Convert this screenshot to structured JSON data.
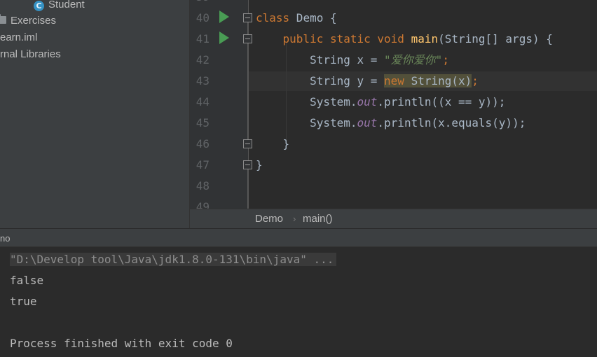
{
  "project_tree": {
    "items": [
      {
        "label": "Student",
        "icon": "class-icon",
        "icon_letter": "C"
      },
      {
        "label": "Exercises",
        "icon": "folder-icon"
      },
      {
        "label": "earn.iml"
      },
      {
        "label": "rnal Libraries"
      }
    ]
  },
  "editor": {
    "line_numbers": [
      "40",
      "41",
      "42",
      "43",
      "44",
      "45",
      "46",
      "47",
      "48",
      "49"
    ],
    "lines": {
      "l40": {
        "kw": "class",
        "rest": " Demo {"
      },
      "l41": {
        "kw1": "public static void",
        "fn": "main",
        "rest": "(String[] args) {"
      },
      "l42": {
        "pre": "String x = ",
        "str": "\"爱你爱你\"",
        "end": ";"
      },
      "l43": {
        "pre": "String y = ",
        "kw": "new",
        "hl": " String(x)",
        "end": ";"
      },
      "l44": {
        "pre": "System.",
        "fld": "out",
        "rest": ".println((x == y));"
      },
      "l45": {
        "pre": "System.",
        "fld": "out",
        "rest": ".println(x.equals(y));"
      },
      "l46": "}",
      "l47": "}"
    }
  },
  "breadcrumb": {
    "class_name": "Demo",
    "separator": "›",
    "method": "main()"
  },
  "run_panel": {
    "title": "no"
  },
  "console": {
    "command": "\"D:\\Develop tool\\Java\\jdk1.8.0-131\\bin\\java\" ...",
    "output": [
      "false",
      "true"
    ],
    "exit_message": "Process finished with exit code 0"
  },
  "colors": {
    "background": "#2b2b2b",
    "keyword": "#cc7832",
    "function": "#ffc66d",
    "string": "#6a8759",
    "field": "#9876aa",
    "run_icon": "#499c54"
  }
}
